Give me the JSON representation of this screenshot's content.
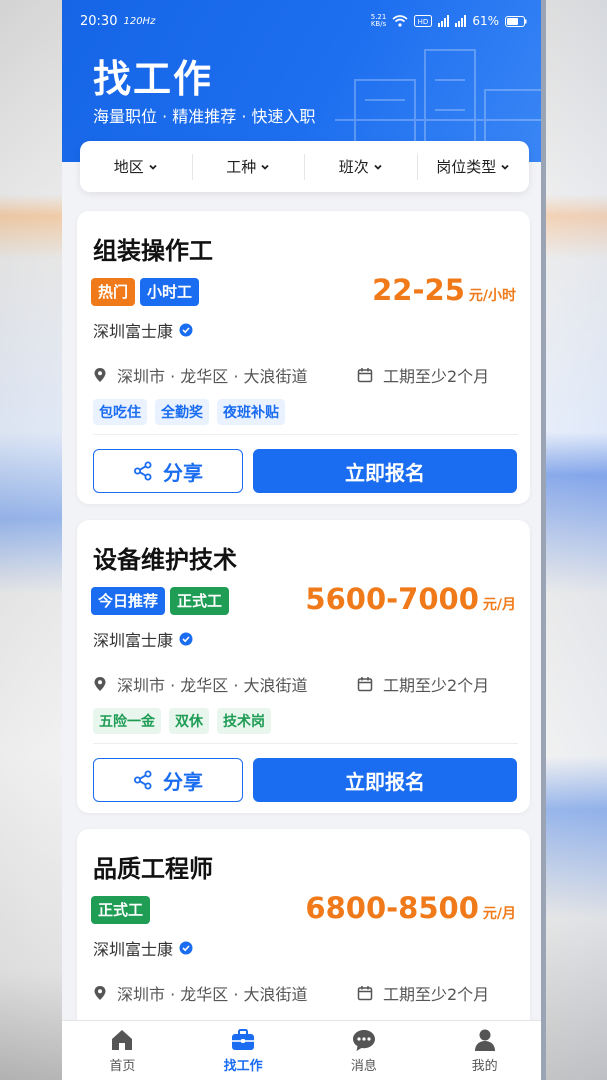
{
  "status": {
    "time": "20:30",
    "refresh": "120Hz",
    "speed_top": "5.21",
    "speed_bottom": "KB/s",
    "battery": "61%"
  },
  "header": {
    "title": "找工作",
    "subtitle": "海量职位 · 精准推荐 · 快速入职"
  },
  "filters": [
    {
      "label": "地区"
    },
    {
      "label": "工种"
    },
    {
      "label": "班次"
    },
    {
      "label": "岗位类型"
    }
  ],
  "jobs": [
    {
      "title": "组装操作工",
      "tags": [
        {
          "text": "热门",
          "color": "#f07a1a"
        },
        {
          "text": "小时工",
          "color": "#1a6cf0"
        }
      ],
      "salary": "22-25",
      "salary_unit": "元/小时",
      "company": "深圳富士康",
      "location": "深圳市 · 龙华区 · 大浪街道",
      "period": "工期至少2个月",
      "chips": [
        "包吃住",
        "全勤奖",
        "夜班补贴"
      ],
      "chip_color": "#1a6cf0",
      "chip_bg": "#eaf2ff",
      "share_label": "分享",
      "apply_label": "立即报名"
    },
    {
      "title": "设备维护技术",
      "tags": [
        {
          "text": "今日推荐",
          "color": "#1a6cf0"
        },
        {
          "text": "正式工",
          "color": "#1f9d55"
        }
      ],
      "salary": "5600-7000",
      "salary_unit": "元/月",
      "company": "深圳富士康",
      "location": "深圳市 · 龙华区 · 大浪街道",
      "period": "工期至少2个月",
      "chips": [
        "五险一金",
        "双休",
        "技术岗"
      ],
      "chip_color": "#1f9d55",
      "chip_bg": "#e8f6ee",
      "share_label": "分享",
      "apply_label": "立即报名"
    },
    {
      "title": "品质工程师",
      "tags": [
        {
          "text": "正式工",
          "color": "#1f9d55"
        }
      ],
      "salary": "6800-8500",
      "salary_unit": "元/月",
      "company": "深圳富士康",
      "location": "深圳市 · 龙华区 · 大浪街道",
      "period": "工期至少2个月"
    }
  ],
  "tabbar": [
    {
      "label": "首页",
      "icon": "home-icon"
    },
    {
      "label": "找工作",
      "icon": "briefcase-icon",
      "active": true
    },
    {
      "label": "消息",
      "icon": "chat-icon"
    },
    {
      "label": "我的",
      "icon": "user-icon"
    }
  ],
  "colors": {
    "primary": "#1a6cf0",
    "salary": "#f07a1a",
    "green": "#1f9d55"
  }
}
